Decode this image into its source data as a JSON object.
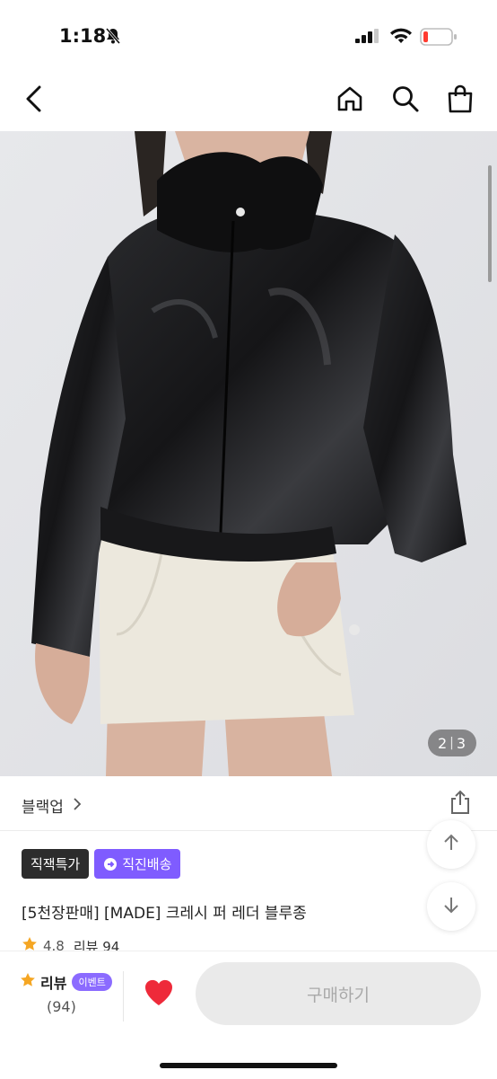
{
  "status": {
    "time": "1:18"
  },
  "nav": {
    "back_icon": "chevron-left-icon",
    "home_icon": "home-icon",
    "search_icon": "search-icon",
    "cart_icon": "shopping-bag-icon"
  },
  "gallery": {
    "current": "2",
    "total": "3"
  },
  "brand": {
    "name": "블랙업",
    "chevron": ">"
  },
  "badges": {
    "special": "직잭특가",
    "delivery": "직진배송"
  },
  "product": {
    "title": "[5천장판매] [MADE] 크레시 퍼 레더 블루종",
    "rating": "4.8",
    "review_label": "리뷰 94"
  },
  "bottom": {
    "review_label": "리뷰",
    "event_label": "이벤트",
    "review_count": "(94)",
    "buy_label": "구매하기"
  },
  "colors": {
    "accent_purple": "#7f5cff",
    "heart_red": "#ee2a3a",
    "star_orange": "#f5a623"
  }
}
